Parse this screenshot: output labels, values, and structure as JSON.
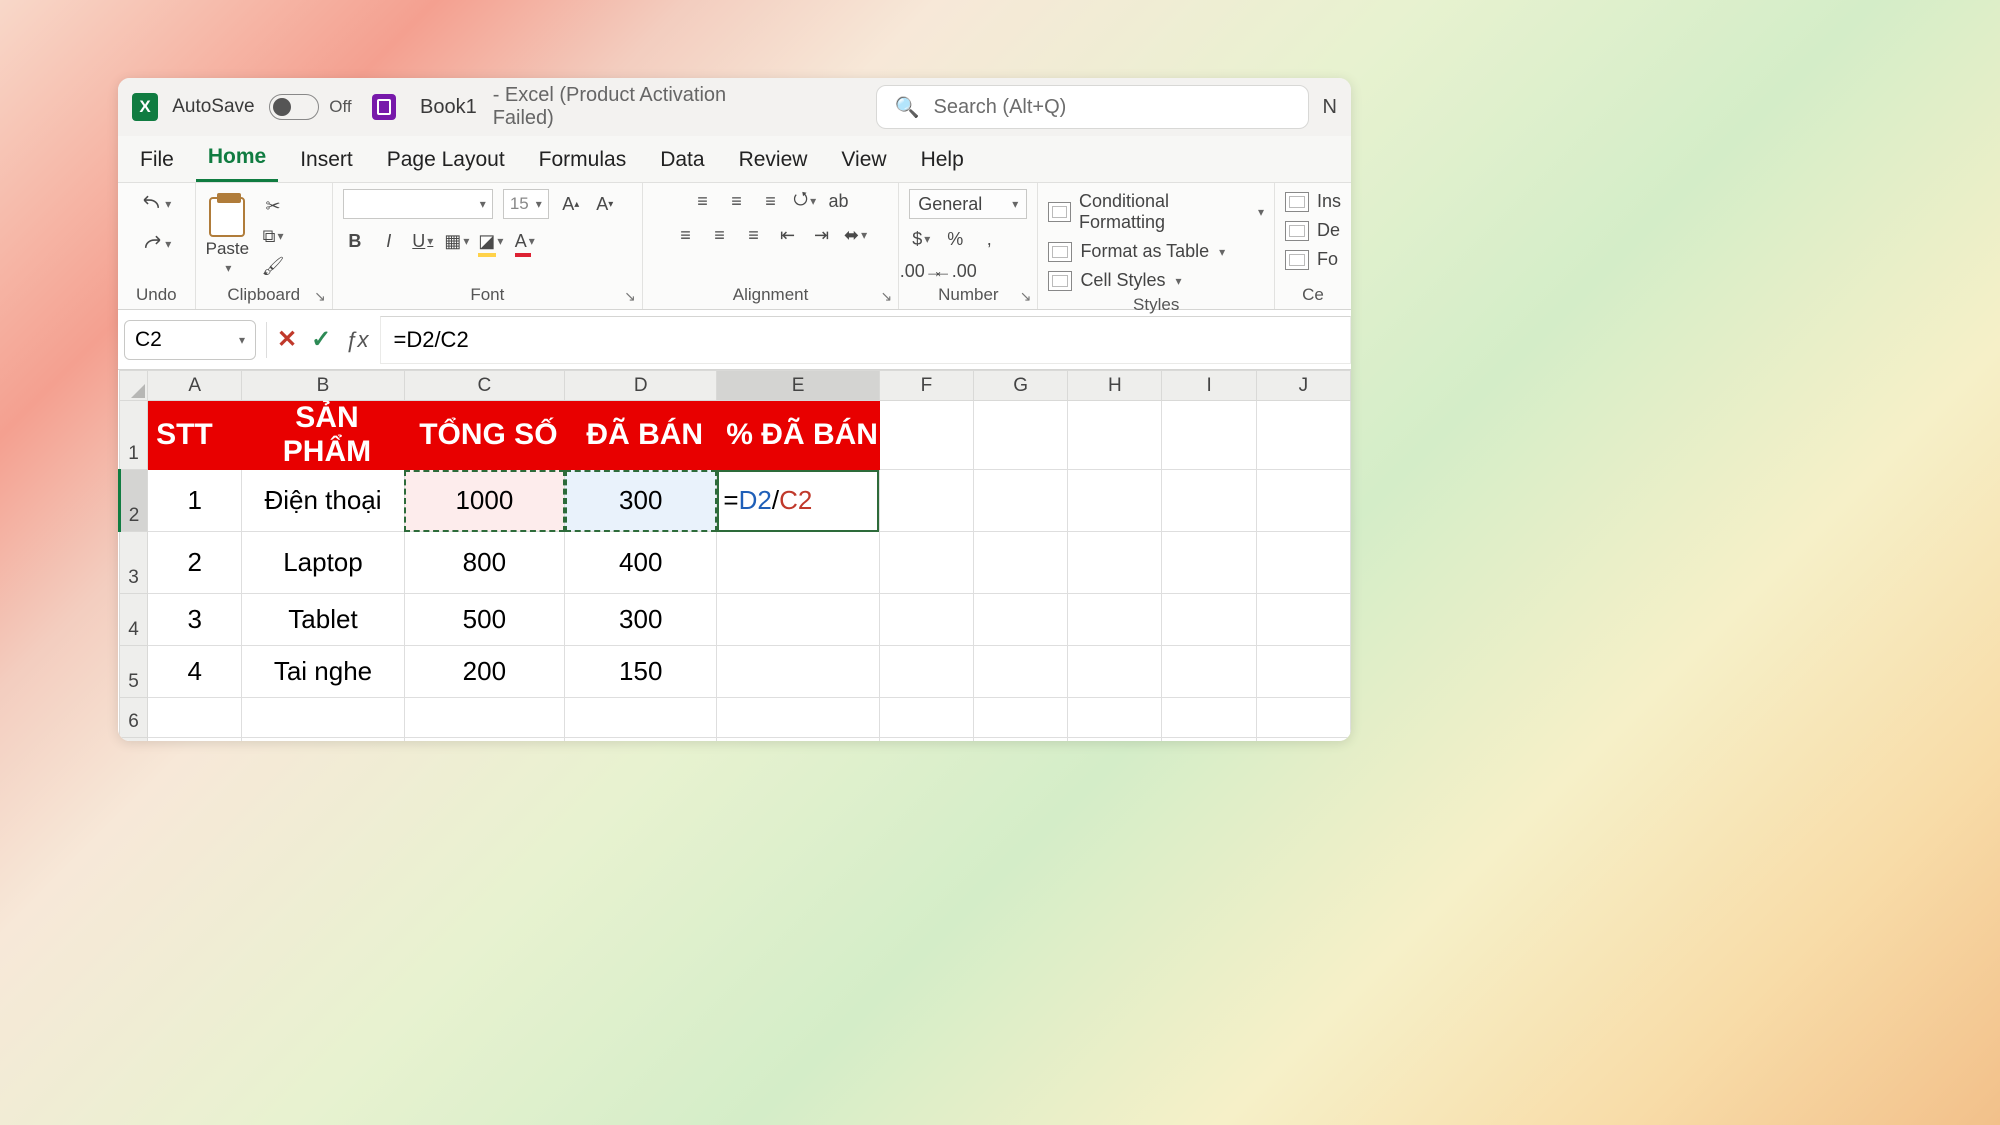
{
  "titlebar": {
    "autosave_label": "AutoSave",
    "autosave_state": "Off",
    "doc_name": "Book1",
    "app_suffix": "  -  Excel (Product Activation Failed)",
    "right_fragment": "N"
  },
  "search": {
    "placeholder": "Search (Alt+Q)"
  },
  "tabs": [
    "File",
    "Home",
    "Insert",
    "Page Layout",
    "Formulas",
    "Data",
    "Review",
    "View",
    "Help"
  ],
  "active_tab": "Home",
  "ribbon": {
    "undo_label": "Undo",
    "clipboard_label": "Clipboard",
    "paste_label": "Paste",
    "font_label": "Font",
    "font_size": "15",
    "alignment_label": "Alignment",
    "number_label": "Number",
    "number_format": "General",
    "styles_label": "Styles",
    "cond_fmt": "Conditional Formatting",
    "fmt_table": "Format as Table",
    "cell_styles": "Cell Styles",
    "cells_label": "Ce",
    "ins": "Ins",
    "del": "De",
    "for": "Fo"
  },
  "formula_bar": {
    "name_box": "C2",
    "formula": "=D2/C2"
  },
  "active_cell_formula_parts": {
    "eq": "=",
    "d2": "D2",
    "slash": "/",
    "c2": "C2"
  },
  "grid": {
    "columns": [
      "A",
      "B",
      "C",
      "D",
      "E",
      "F",
      "G",
      "H",
      "I",
      "J"
    ],
    "header_row": {
      "stt": "STT",
      "sp": "SẢN PHẨM",
      "tong": "TỔNG SỐ",
      "daban": "ĐÃ BÁN",
      "pct": "% ĐÃ BÁN"
    },
    "rows": [
      {
        "stt": "1",
        "sp": "Điện thoại",
        "tong": "1000",
        "daban": "300"
      },
      {
        "stt": "2",
        "sp": "Laptop",
        "tong": "800",
        "daban": "400"
      },
      {
        "stt": "3",
        "sp": "Tablet",
        "tong": "500",
        "daban": "300"
      },
      {
        "stt": "4",
        "sp": "Tai nghe",
        "tong": "200",
        "daban": "150"
      }
    ]
  },
  "chart_data": {
    "type": "table",
    "title": "",
    "columns": [
      "STT",
      "SẢN PHẨM",
      "TỔNG SỐ",
      "ĐÃ BÁN",
      "% ĐÃ BÁN"
    ],
    "rows": [
      [
        1,
        "Điện thoại",
        1000,
        300,
        null
      ],
      [
        2,
        "Laptop",
        800,
        400,
        null
      ],
      [
        3,
        "Tablet",
        500,
        300,
        null
      ],
      [
        4,
        "Tai nghe",
        200,
        150,
        null
      ]
    ]
  }
}
